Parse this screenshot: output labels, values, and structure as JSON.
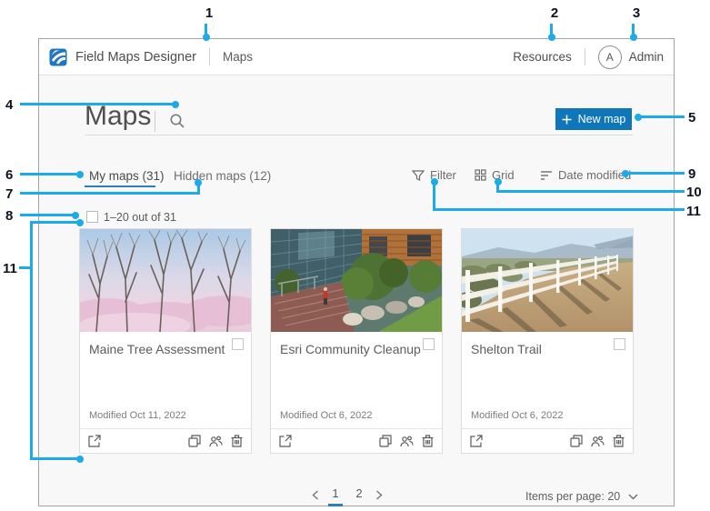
{
  "colors": {
    "accent_blue": "#0e76b9",
    "callout_blue": "#1caae9",
    "tab_underline_blue": "#2e7dbc"
  },
  "header": {
    "logo": "esri-logo",
    "app_title": "Field Maps Designer",
    "nav_maps": "Maps",
    "resources": "Resources",
    "avatar_initial": "A",
    "username": "Admin"
  },
  "toolbar": {
    "page_title": "Maps",
    "search_icon": "search-icon",
    "new_map_label": "New map"
  },
  "tabs": {
    "my_maps": "My maps (31)",
    "hidden_maps": "Hidden maps (12)"
  },
  "list_controls": {
    "filter": "Filter",
    "grid": "Grid",
    "sort": "Date modified",
    "selection_label": "1–20 out of 31"
  },
  "cards": [
    {
      "title": "Maine Tree Assessment",
      "modified": "Modified Oct 11, 2022",
      "thumbnail": "bare-trees-pink-blossoms"
    },
    {
      "title": "Esri Community Cleanup",
      "modified": "Modified Oct 6, 2022",
      "thumbnail": "esri-campus-garden"
    },
    {
      "title": "Shelton Trail",
      "modified": "Modified Oct 6, 2022",
      "thumbnail": "white-fence-dirt-trail"
    }
  ],
  "pagination": {
    "page1": "1",
    "page2": "2",
    "items_per_page": "Items per page: 20"
  },
  "callouts": {
    "n1": "1",
    "n2": "2",
    "n3": "3",
    "n4": "4",
    "n5": "5",
    "n6": "6",
    "n7": "7",
    "n8": "8",
    "n9": "9",
    "n10": "10",
    "n11": "11"
  }
}
